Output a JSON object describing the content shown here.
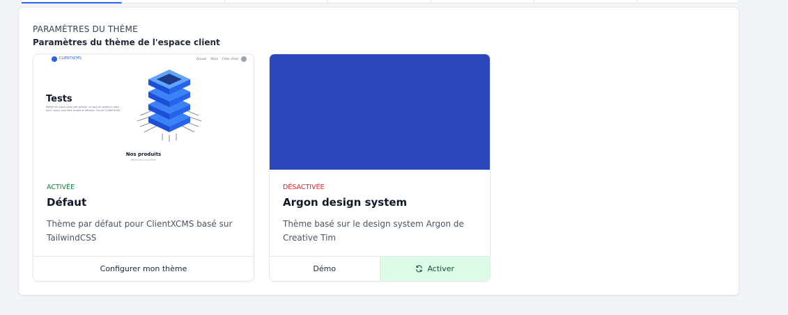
{
  "section": {
    "title": "PARAMÈTRES DU THÈME",
    "subtitle": "Paramètres du thème de l'espace client"
  },
  "themes": [
    {
      "status": "ACTIVÉE",
      "name": "Défaut",
      "description": "Thème par défaut pour ClientXCMS basé sur TailwindCSS",
      "buttons": [
        "Configurer mon thème"
      ],
      "preview": {
        "brand": "CLIENTXCMS",
        "nav_links": [
          "Accueil",
          "Store",
          "Créer client"
        ],
        "hero_title": "Tests",
        "hero_text": "Mettez en place votre site web en un seul clic grâce à notre outil, conçu pour être simple et efficace. Forum CLIENTXCMS.",
        "products_title": "Nos produits",
        "products_subtitle": "Découvrez nos offres"
      }
    },
    {
      "status": "DÉSACTIVÉE",
      "name": "Argon design system",
      "description": "Thème basé sur le design system Argon de Creative Tim",
      "buttons": [
        "Démo",
        "Activer"
      ],
      "preview_color": "#2c46bb"
    }
  ],
  "icons": {
    "activate": "refresh-icon"
  },
  "colors": {
    "active_status": "#15803d",
    "inactive_status": "#dc2626",
    "activate_bg": "#dcfce7"
  }
}
